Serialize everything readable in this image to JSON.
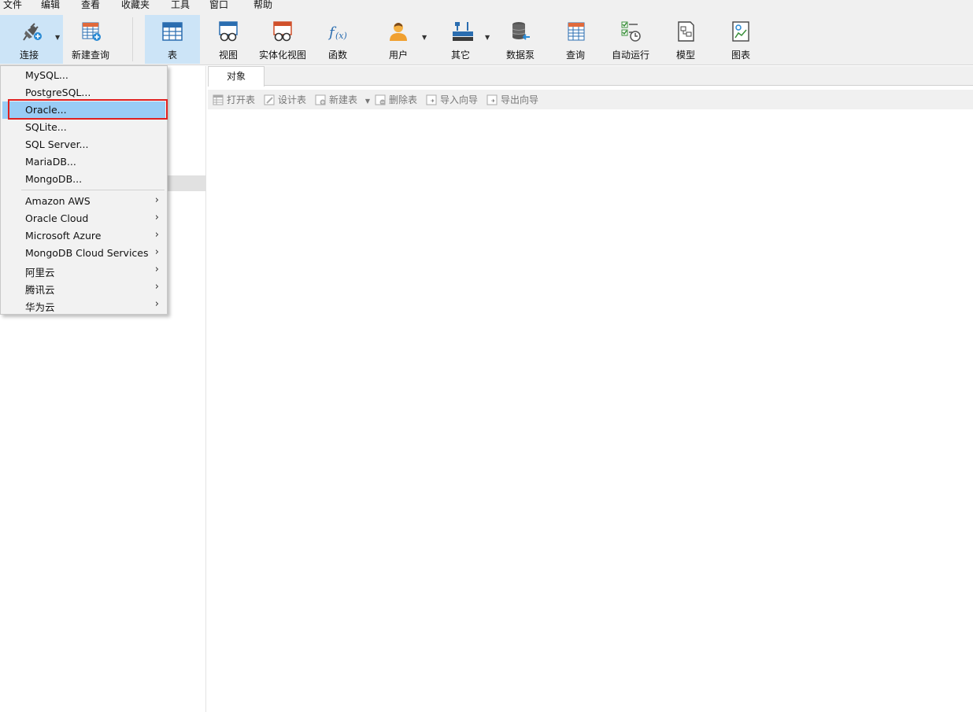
{
  "menubar": [
    "文件",
    "编辑",
    "查看",
    "收藏夹",
    "工具",
    "窗口",
    "帮助"
  ],
  "toolbar": {
    "connect": "连接",
    "new_query": "新建查询",
    "table": "表",
    "view": "视图",
    "materialized_view": "实体化视图",
    "function": "函数",
    "user": "用户",
    "other": "其它",
    "datapump": "数据泵",
    "query": "查询",
    "automation": "自动运行",
    "model": "模型",
    "chart": "图表"
  },
  "tabs": {
    "objects": "对象"
  },
  "object_toolbar": {
    "open_table": "打开表",
    "design_table": "设计表",
    "new_table": "新建表",
    "delete_table": "删除表",
    "import_wizard": "导入向导",
    "export_wizard": "导出向导"
  },
  "connect_menu": {
    "items": [
      "MySQL...",
      "PostgreSQL...",
      "Oracle...",
      "SQLite...",
      "SQL Server...",
      "MariaDB...",
      "MongoDB..."
    ],
    "cloud": [
      "Amazon AWS",
      "Oracle Cloud",
      "Microsoft Azure",
      "MongoDB Cloud Services",
      "阿里云",
      "腾讯云",
      "华为云"
    ],
    "highlighted": "Oracle..."
  }
}
